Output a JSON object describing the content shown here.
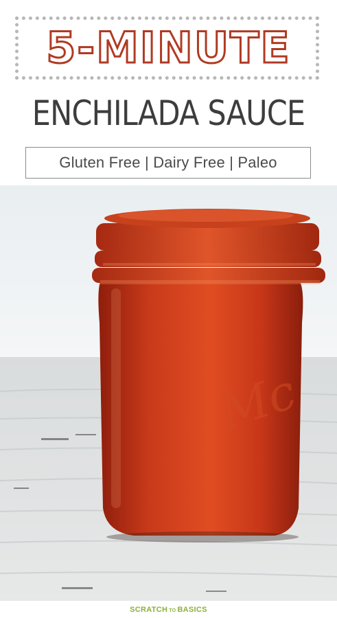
{
  "header": {
    "title_line1": "5-MINUTE",
    "title_line2": "ENCHILADA SAUCE",
    "tags": "Gluten Free | Dairy Free | Paleo"
  },
  "photo": {
    "subject": "jar-of-sauce"
  },
  "footer": {
    "brand_left": "SCRATCH",
    "brand_mid": "TO",
    "brand_right": "BASICS"
  },
  "colors": {
    "title_red": "#b03a22",
    "title_dark": "#3d3d3d",
    "sauce": "#c7361a",
    "brand_green": "#8cb03a"
  }
}
